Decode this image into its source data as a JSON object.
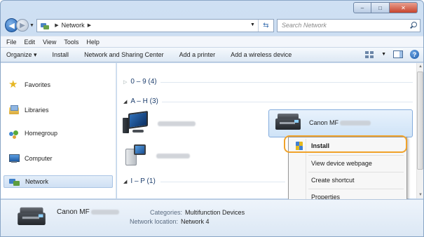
{
  "window": {
    "minimize": "–",
    "maximize": "□",
    "close": "✕"
  },
  "address": {
    "crumbs": [
      "Network"
    ],
    "search_placeholder": "Search Network"
  },
  "menu": {
    "file": "File",
    "edit": "Edit",
    "view": "View",
    "tools": "Tools",
    "help": "Help"
  },
  "commands": {
    "organize": "Organize ▾",
    "install": "Install",
    "network_center": "Network and Sharing Center",
    "add_printer": "Add a printer",
    "add_wireless": "Add a wireless device",
    "help": "?"
  },
  "sidebar": {
    "items": [
      {
        "label": "Favorites"
      },
      {
        "label": "Libraries"
      },
      {
        "label": "Homegroup"
      },
      {
        "label": "Computer"
      },
      {
        "label": "Network"
      }
    ]
  },
  "groups": [
    {
      "label": "0 – 9 (4)",
      "expanded": false
    },
    {
      "label": "A – H (3)",
      "expanded": true
    },
    {
      "label": "I – P (1)",
      "expanded": true
    }
  ],
  "devices": [
    {
      "label": "Canon MF",
      "type": "printer",
      "selected": true
    }
  ],
  "context_menu": {
    "items": [
      "Install",
      "View device webpage",
      "Create shortcut",
      "Properties"
    ]
  },
  "details": {
    "name": "Canon MF",
    "categories_key": "Categories:",
    "categories_value": "Multifunction Devices",
    "location_key": "Network location:",
    "location_value": "Network 4"
  },
  "colors": {
    "highlight_ring": "#f0a22a",
    "selection": "#cfe3f7"
  }
}
